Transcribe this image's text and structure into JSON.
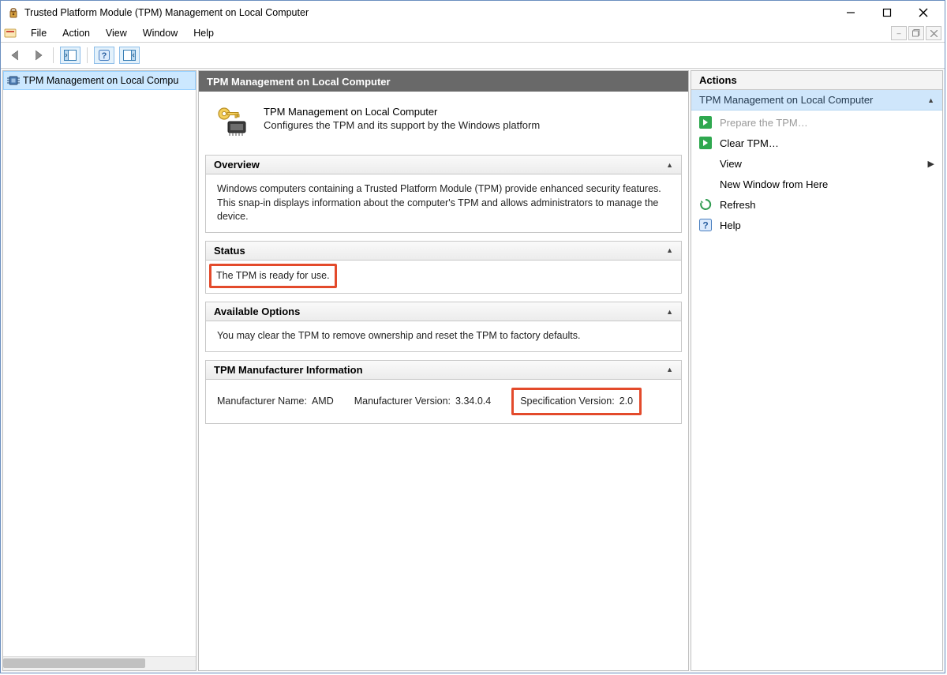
{
  "window": {
    "title": "Trusted Platform Module (TPM) Management on Local Computer"
  },
  "menu": {
    "items": [
      "File",
      "Action",
      "View",
      "Window",
      "Help"
    ]
  },
  "left": {
    "tree_item": "TPM Management on Local Compu"
  },
  "center": {
    "header": "TPM Management on Local Computer",
    "intro_title": "TPM Management on Local Computer",
    "intro_desc": "Configures the TPM and its support by the Windows platform",
    "overview": {
      "label": "Overview",
      "body": "Windows computers containing a Trusted Platform Module (TPM) provide enhanced security features. This snap-in displays information about the computer's TPM and allows administrators to manage the device."
    },
    "status": {
      "label": "Status",
      "body": "The TPM is ready for use."
    },
    "options": {
      "label": "Available Options",
      "body": "You may clear the TPM to remove ownership and reset the TPM to factory defaults."
    },
    "manuf": {
      "label": "TPM Manufacturer Information",
      "mfr_name_label": "Manufacturer Name:",
      "mfr_name_value": "AMD",
      "mfr_ver_label": "Manufacturer Version:",
      "mfr_ver_value": "3.34.0.4",
      "spec_ver_label": "Specification Version:",
      "spec_ver_value": "2.0"
    }
  },
  "right": {
    "title": "Actions",
    "subheader": "TPM Management on Local Computer",
    "items": {
      "prepare": "Prepare the TPM…",
      "clear": "Clear TPM…",
      "view": "View",
      "newwin": "New Window from Here",
      "refresh": "Refresh",
      "help": "Help"
    }
  }
}
